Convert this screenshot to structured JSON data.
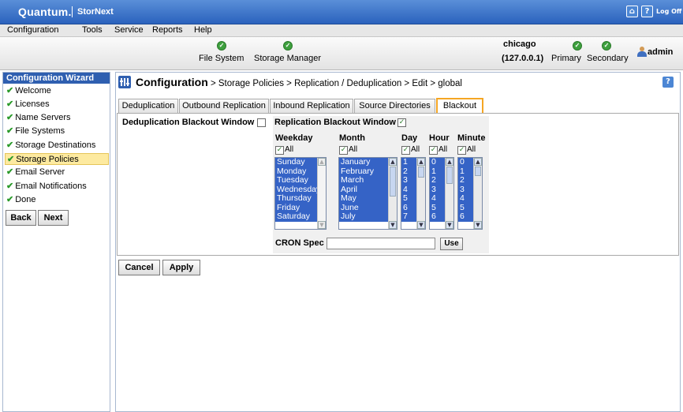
{
  "app": {
    "brand": "Quantum.",
    "product": "StorNext",
    "home_icon": "home-icon",
    "help_icon": "help-icon",
    "logoff_label": "Log Off"
  },
  "menu": [
    "Configuration",
    "Tools",
    "Service",
    "Reports",
    "Help"
  ],
  "status": {
    "file_system": "File System",
    "storage_manager": "Storage Manager",
    "host": "chicago",
    "ip": "(127.0.0.1)",
    "primary": "Primary",
    "secondary": "Secondary",
    "user": "admin"
  },
  "wizard": {
    "title": "Configuration Wizard",
    "items": [
      "Welcome",
      "Licenses",
      "Name Servers",
      "File Systems",
      "Storage Destinations",
      "Storage Policies",
      "Email Server",
      "Email Notifications",
      "Done"
    ],
    "active_index": 5,
    "back": "Back",
    "next": "Next"
  },
  "breadcrumb": {
    "root": "Configuration",
    "path": " > Storage Policies > Replication / Deduplication > Edit > global"
  },
  "tabs": [
    "Deduplication",
    "Outbound Replication",
    "Inbound Replication",
    "Source Directories",
    "Blackout"
  ],
  "active_tab": "Blackout",
  "dedup_label": "Deduplication Blackout Window",
  "repl_label": "Replication Blackout Window",
  "columns": {
    "weekday": {
      "header": "Weekday",
      "all": "All",
      "options": [
        "Sunday",
        "Monday",
        "Tuesday",
        "Wednesday",
        "Thursday",
        "Friday",
        "Saturday"
      ]
    },
    "month": {
      "header": "Month",
      "all": "All",
      "options": [
        "January",
        "February",
        "March",
        "April",
        "May",
        "June",
        "July"
      ]
    },
    "day": {
      "header": "Day",
      "all": "All",
      "options": [
        "1",
        "2",
        "3",
        "4",
        "5",
        "6",
        "7"
      ]
    },
    "hour": {
      "header": "Hour",
      "all": "All",
      "options": [
        "0",
        "1",
        "2",
        "3",
        "4",
        "5",
        "6"
      ]
    },
    "minute": {
      "header": "Minute",
      "all": "All",
      "options": [
        "0",
        "1",
        "2",
        "3",
        "4",
        "5",
        "6"
      ]
    }
  },
  "cron": {
    "label": "CRON Spec",
    "value": "",
    "use": "Use"
  },
  "actions": {
    "cancel": "Cancel",
    "apply": "Apply"
  },
  "colors": {
    "accent": "#2f5fb0",
    "selection": "#3563c6",
    "active_tab": "#f5a623",
    "check": "#2a9a2a"
  }
}
